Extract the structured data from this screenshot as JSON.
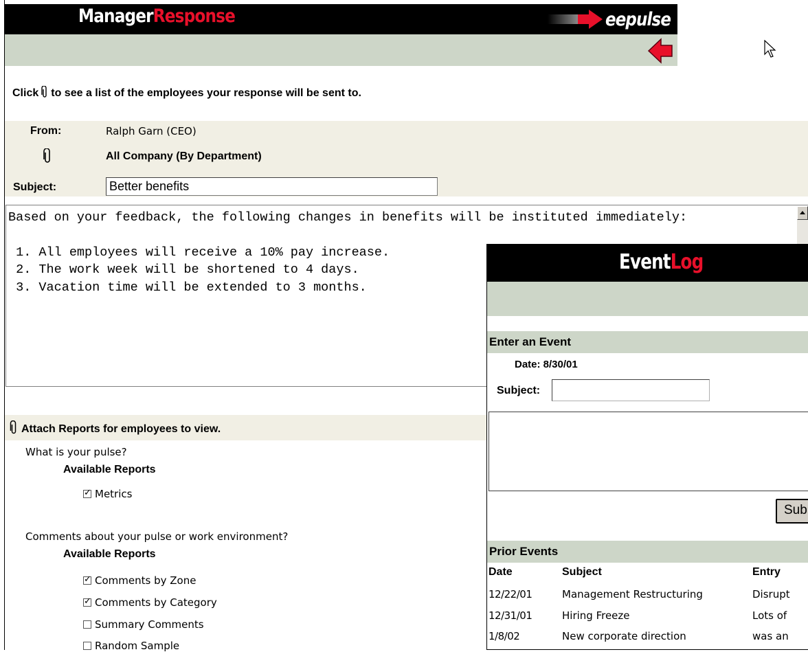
{
  "header": {
    "logo_part1": "Manager",
    "logo_part2": "Response",
    "brand": "eepulse"
  },
  "instruction": {
    "before": "Click",
    "after": "to see a list of the employees your response will be sent to."
  },
  "from": {
    "label": "From:",
    "value": "Ralph Garn (CEO)"
  },
  "recipients": {
    "value": "All Company (By Department)"
  },
  "subject": {
    "label": "Subject:",
    "value": "Better benefits"
  },
  "message": {
    "line1": "Based on your feedback, the following changes in benefits will be instituted immediately:",
    "line2": " 1. All employees will receive a 10% pay increase.",
    "line3": " 2. The work week will be shortened to 4 days.",
    "line4": " 3. Vacation time will be extended to 3 months."
  },
  "attach": {
    "label": "Attach Reports for employees to view.",
    "q1": "What is your pulse?",
    "q1_avail": "Available Reports",
    "q1_items": [
      {
        "label": "Metrics",
        "checked": true
      }
    ],
    "q2": "Comments about your pulse or work environment?",
    "q2_avail": "Available Reports",
    "q2_items": [
      {
        "label": "Comments by Zone",
        "checked": true
      },
      {
        "label": "Comments by Category",
        "checked": true
      },
      {
        "label": "Summary Comments",
        "checked": false
      },
      {
        "label": "Random Sample",
        "checked": false
      }
    ]
  },
  "eventlog": {
    "logo_part1": "Event",
    "logo_part2": "Log",
    "enter_title": "Enter an Event",
    "date_text": "Date: 8/30/01",
    "subject_label": "Subject:",
    "submit_label": "Submit",
    "prior_title": "Prior Events",
    "columns": [
      "Date",
      "Subject",
      "Entry"
    ],
    "rows": [
      {
        "date": "12/22/01",
        "subject": "Management Restructuring",
        "entry": "Disrupt"
      },
      {
        "date": "12/31/01",
        "subject": "Hiring Freeze",
        "entry": "Lots of"
      },
      {
        "date": "1/8/02",
        "subject": "New corporate direction",
        "entry": "was an"
      }
    ]
  },
  "colors": {
    "header_black": "#000000",
    "accent_red": "#e8102a",
    "band_green": "#cdd6c8",
    "band_beige": "#f1efe4"
  },
  "icons": {
    "back": "red-left-arrow-icon",
    "clip": "paperclip-icon",
    "cursor": "mouse-pointer-icon"
  }
}
